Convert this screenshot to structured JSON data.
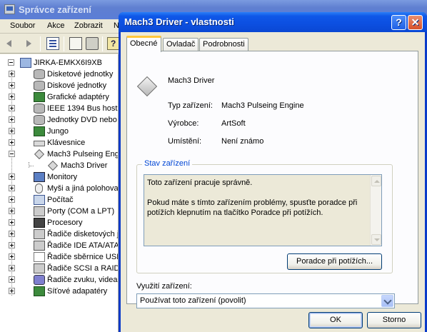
{
  "background_window": {
    "title": "Správce zařízení",
    "menu": [
      "Soubor",
      "Akce",
      "Zobrazit",
      "N"
    ],
    "tree": [
      {
        "label": "JIRKA-EMKX6I9XB",
        "icon": "computer-icon",
        "level": 0,
        "expander": "minus"
      },
      {
        "label": "Disketové jednotky",
        "icon": "floppy-drive-icon",
        "level": 1,
        "expander": "plus"
      },
      {
        "label": "Diskové jednotky",
        "icon": "hard-disk-icon",
        "level": 1,
        "expander": "plus"
      },
      {
        "label": "Grafické adaptéry",
        "icon": "display-adapter-icon",
        "level": 1,
        "expander": "plus"
      },
      {
        "label": "IEEE 1394 Bus host c",
        "icon": "ieee1394-icon",
        "level": 1,
        "expander": "plus"
      },
      {
        "label": "Jednotky DVD nebo C",
        "icon": "dvd-drive-icon",
        "level": 1,
        "expander": "plus"
      },
      {
        "label": "Jungo",
        "icon": "jungo-card-icon",
        "level": 1,
        "expander": "plus"
      },
      {
        "label": "Klávesnice",
        "icon": "keyboard-icon",
        "level": 1,
        "expander": "plus"
      },
      {
        "label": "Mach3 Pulseing Engin",
        "icon": "mach3-diamond-icon",
        "level": 1,
        "expander": "minus"
      },
      {
        "label": "Mach3 Driver",
        "icon": "mach3-diamond-icon",
        "level": 2,
        "expander": "none"
      },
      {
        "label": "Monitory",
        "icon": "monitor-icon",
        "level": 1,
        "expander": "plus"
      },
      {
        "label": "Myši a jiná polohovac",
        "icon": "mouse-icon",
        "level": 1,
        "expander": "plus"
      },
      {
        "label": "Počítač",
        "icon": "computer-small-icon",
        "level": 1,
        "expander": "plus"
      },
      {
        "label": "Porty (COM a LPT)",
        "icon": "port-icon",
        "level": 1,
        "expander": "plus"
      },
      {
        "label": "Procesory",
        "icon": "processor-icon",
        "level": 1,
        "expander": "plus"
      },
      {
        "label": "Řadiče disketových je",
        "icon": "floppy-controller-icon",
        "level": 1,
        "expander": "plus"
      },
      {
        "label": "Řadiče IDE ATA/ATAP",
        "icon": "ide-controller-icon",
        "level": 1,
        "expander": "plus"
      },
      {
        "label": "Řadiče sběrnice USB",
        "icon": "usb-icon",
        "level": 1,
        "expander": "plus"
      },
      {
        "label": "Řadiče SCSI a RAID",
        "icon": "scsi-controller-icon",
        "level": 1,
        "expander": "plus"
      },
      {
        "label": "Řadiče zvuku, videa",
        "icon": "sound-icon",
        "level": 1,
        "expander": "plus"
      },
      {
        "label": "Síťové adapatéry",
        "icon": "network-adapter-icon",
        "level": 1,
        "expander": "plus"
      }
    ]
  },
  "dialog": {
    "title": "Mach3 Driver - vlastnosti",
    "help_glyph": "?",
    "close_glyph": "✕",
    "tabs": [
      {
        "label": "Obecné",
        "active": true
      },
      {
        "label": "Ovladač",
        "active": false
      },
      {
        "label": "Podrobnosti",
        "active": false
      }
    ],
    "device_name": "Mach3 Driver",
    "props": {
      "type_label": "Typ zařízení:",
      "type_value": "Mach3 Pulseing Engine",
      "maker_label": "Výrobce:",
      "maker_value": "ArtSoft",
      "location_label": "Umístění:",
      "location_value": "Není známo"
    },
    "status": {
      "legend": "Stav zařízení",
      "text": "Toto zařízení pracuje správně.\n\nPokud máte s tímto zařízením problémy, spusťte poradce při potížích klepnutím na tlačítko Poradce při potížích.",
      "troubleshoot_button": "Poradce při potížích..."
    },
    "usage": {
      "label": "Využití zařízení:",
      "selected": "Používat toto zařízení (povolit)"
    },
    "buttons": {
      "ok": "OK",
      "cancel": "Storno"
    }
  }
}
